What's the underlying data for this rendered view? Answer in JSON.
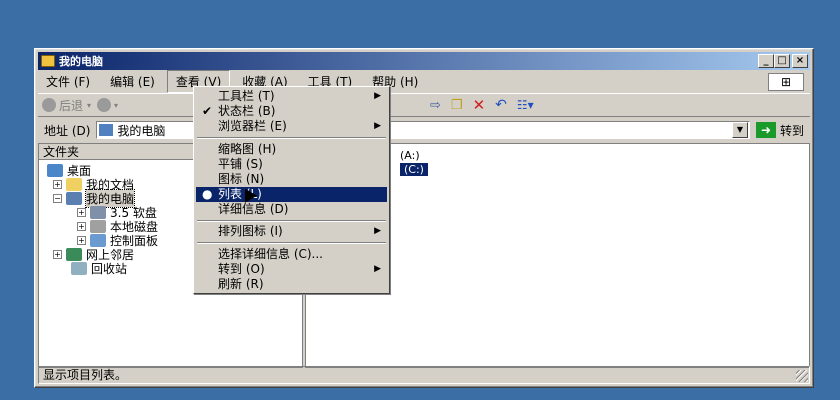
{
  "window": {
    "title": "我的电脑",
    "controls": [
      "_",
      "□",
      "×"
    ]
  },
  "menubar": [
    "文件 (F)",
    "编辑 (E)",
    "查看 (V)",
    "收藏 (A)",
    "工具 (T)",
    "帮助 (H)"
  ],
  "toolbar": {
    "back": "后退",
    "forward": ""
  },
  "address": {
    "label": "地址 (D)",
    "value": "我的电脑",
    "go": "转到"
  },
  "left_pane": {
    "title": "文件夹",
    "tree": [
      {
        "label": "桌面"
      },
      {
        "label": "我的文档",
        "pm": "+"
      },
      {
        "label": "我的电脑",
        "pm": "−"
      },
      {
        "label": "3.5 软盘",
        "pm": "+"
      },
      {
        "label": "本地磁盘",
        "pm": "+"
      },
      {
        "label": "控制面板",
        "pm": "+"
      },
      {
        "label": "网上邻居",
        "pm": "+"
      },
      {
        "label": "回收站"
      }
    ]
  },
  "list": [
    {
      "text": "(A:)"
    },
    {
      "text": "(C:)"
    }
  ],
  "view_menu": {
    "items": [
      {
        "label": "工具栏 (T)",
        "submenu": true
      },
      {
        "label": "状态栏 (B)",
        "mark": "✔"
      },
      {
        "label": "浏览器栏 (E)",
        "submenu": true
      },
      {
        "separator": true
      },
      {
        "label": "缩略图 (H)"
      },
      {
        "label": "平铺 (S)"
      },
      {
        "label": "图标 (N)"
      },
      {
        "label": "列表 (L)",
        "mark": "●",
        "highlight": true
      },
      {
        "label": "详细信息 (D)"
      },
      {
        "separator": true
      },
      {
        "label": "排列图标 (I)",
        "submenu": true
      },
      {
        "separator": true
      },
      {
        "label": "选择详细信息 (C)..."
      },
      {
        "label": "转到 (O)",
        "submenu": true
      },
      {
        "label": "刷新 (R)"
      }
    ]
  },
  "status": "显示项目列表。"
}
